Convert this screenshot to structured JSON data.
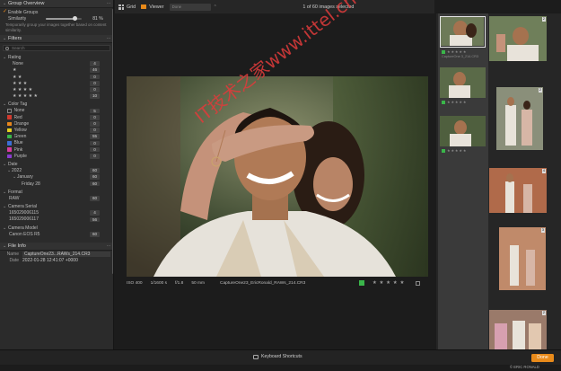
{
  "left_panel": {
    "group_overview": {
      "title": "Group Overview",
      "enable_groups": "Enable Groups",
      "similarity_label": "Similarity",
      "similarity_value": "81 %",
      "similarity_fraction": 0.81,
      "help_text": "Temporarily group your images together based on content similarity."
    },
    "filters": {
      "title": "Filters",
      "search_placeholder": "Search",
      "rating": {
        "title": "Rating",
        "rows": [
          {
            "label": "None",
            "count": "4"
          },
          {
            "label": "★",
            "count": "46"
          },
          {
            "label": "★ ★",
            "count": "0"
          },
          {
            "label": "★ ★ ★",
            "count": "0"
          },
          {
            "label": "★ ★ ★ ★",
            "count": "0"
          },
          {
            "label": "★ ★ ★ ★ ★",
            "count": "10"
          }
        ]
      },
      "color_tag": {
        "title": "Color Tag",
        "rows": [
          {
            "label": "None",
            "count": "5",
            "color": "#2b2b2b"
          },
          {
            "label": "Red",
            "count": "0",
            "color": "#d23a2e"
          },
          {
            "label": "Orange",
            "count": "0",
            "color": "#e8871c"
          },
          {
            "label": "Yellow",
            "count": "0",
            "color": "#e6cf20"
          },
          {
            "label": "Green",
            "count": "55",
            "color": "#3ab54a"
          },
          {
            "label": "Blue",
            "count": "0",
            "color": "#3c6ed6"
          },
          {
            "label": "Pink",
            "count": "0",
            "color": "#d83ca0"
          },
          {
            "label": "Purple",
            "count": "0",
            "color": "#8a3cd0"
          }
        ]
      },
      "date": {
        "title": "Date",
        "year": "2022",
        "year_count": "60",
        "month": "January",
        "month_count": "60",
        "day": "Friday 28",
        "day_count": "60"
      },
      "format": {
        "title": "Format",
        "value": "RAW",
        "count": "60"
      },
      "camera_serial": {
        "title": "Camera Serial",
        "rows": [
          {
            "label": "165029006115",
            "count": "4"
          },
          {
            "label": "165029006117",
            "count": "56"
          }
        ]
      },
      "camera_model": {
        "title": "Camera Model",
        "value": "Canon EOS R5",
        "count": "60"
      }
    },
    "file_info": {
      "title": "File Info",
      "name_label": "Name",
      "name_value": "CaptureOne23...RAWs_214.CR3",
      "date_label": "Date",
      "date_value": "2022-01-28 12:41:07 +0000"
    }
  },
  "toolbar": {
    "grid_label": "Grid",
    "viewer_label": "Viewer",
    "zoom_value": "Done",
    "selection_text": "1 of 60 images selected"
  },
  "viewer": {
    "iso": "ISO 400",
    "shutter": "1/1600 s",
    "aperture": "f/1.8",
    "focal": "50 mm",
    "filename": "CaptureOne23_EricRonald_RAWs_214.CR3",
    "rating_stars": "★ ★ ★ ★ ★"
  },
  "filmstrip": {
    "badges": [
      "2",
      "2",
      "4",
      "3",
      "2"
    ],
    "thumb_stars": "★ ★ ★ ★ ★",
    "thumb_caption": "CaptureOne 3_214.CR3"
  },
  "bottom": {
    "keyboard_shortcuts": "Keyboard Shortcuts",
    "done": "Done",
    "copyright": "© ERIC RONALD"
  },
  "watermark": "IT技术之家www.ittel.cn",
  "colors": {
    "accent": "#e88a1a",
    "green_tag": "#3ab54a"
  }
}
